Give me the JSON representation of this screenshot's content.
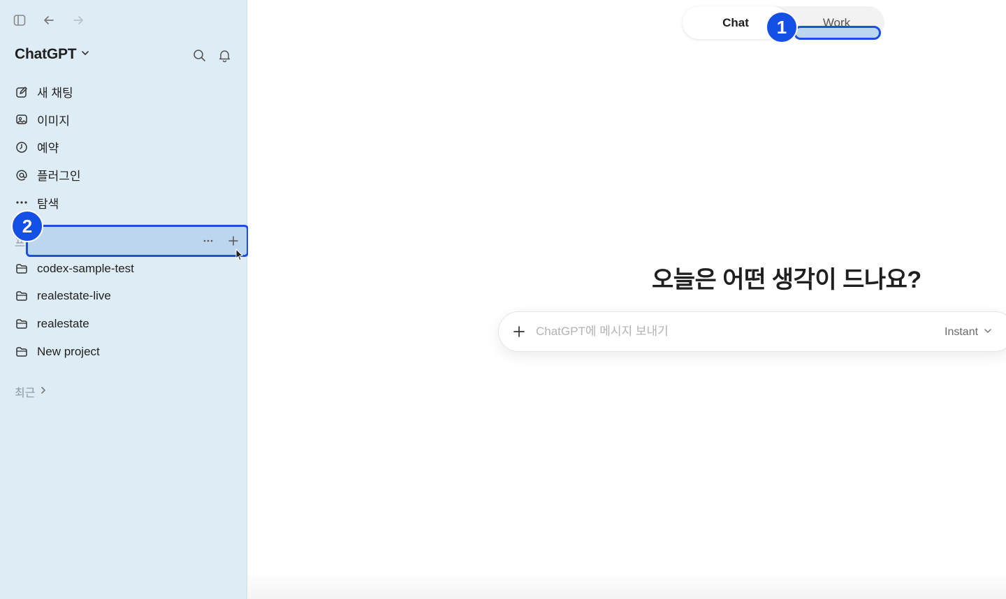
{
  "sidebar": {
    "brand": "ChatGPT",
    "nav": [
      {
        "label": "새 채팅",
        "icon": "edit-icon"
      },
      {
        "label": "이미지",
        "icon": "image-icon"
      },
      {
        "label": "예약",
        "icon": "clock-icon"
      },
      {
        "label": "플러그인",
        "icon": "at-icon"
      },
      {
        "label": "탐색",
        "icon": "more-icon"
      }
    ],
    "projects_label": "프로젝트",
    "projects": [
      {
        "label": "codex-sample-test",
        "icon": "folder-icon"
      },
      {
        "label": "realestate-live",
        "icon": "folder-icon"
      },
      {
        "label": "realestate",
        "icon": "folder-icon"
      },
      {
        "label": "New project",
        "icon": "folder-icon"
      }
    ],
    "recent_label": "최근"
  },
  "main": {
    "toggle": {
      "chat": "Chat",
      "work": "Work"
    },
    "hero": "오늘은 어떤 생각이 드나요?",
    "composer": {
      "placeholder": "ChatGPT에 메시지 보내기",
      "model": "Instant"
    }
  },
  "annotations": {
    "badge1": "1",
    "badge2": "2"
  },
  "colors": {
    "sidebar_bg": "#deedf5",
    "annotation_blue": "#1450e6",
    "highlight": "#bcd6ef"
  }
}
